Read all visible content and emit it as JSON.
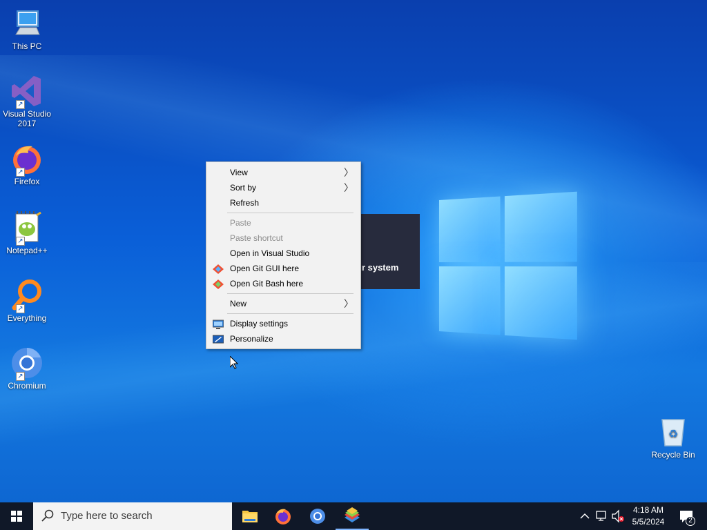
{
  "desktop": {
    "icons": [
      {
        "label": "This PC",
        "icon": "this-pc-icon"
      },
      {
        "label": "Visual Studio 2017",
        "icon": "visual-studio-icon"
      },
      {
        "label": "Firefox",
        "icon": "firefox-icon"
      },
      {
        "label": "Notepad++",
        "icon": "notepad-plus-plus-icon"
      },
      {
        "label": "Everything",
        "icon": "everything-icon"
      },
      {
        "label": "Chromium",
        "icon": "chromium-icon"
      },
      {
        "label": "Recycle Bin",
        "icon": "recycle-bin-icon"
      }
    ],
    "background_popup_text": "ur system"
  },
  "context_menu": {
    "items": [
      {
        "label": "View",
        "submenu": true
      },
      {
        "label": "Sort by",
        "submenu": true
      },
      {
        "label": "Refresh"
      },
      {
        "label": "Paste",
        "disabled": true
      },
      {
        "label": "Paste shortcut",
        "disabled": true
      },
      {
        "label": "Open in Visual Studio"
      },
      {
        "label": "Open Git GUI here",
        "icon": "git-gui-icon"
      },
      {
        "label": "Open Git Bash here",
        "icon": "git-bash-icon"
      },
      {
        "label": "New",
        "submenu": true
      },
      {
        "label": "Display settings",
        "icon": "display-settings-icon"
      },
      {
        "label": "Personalize",
        "icon": "personalize-icon"
      }
    ]
  },
  "taskbar": {
    "search_placeholder": "Type here to search",
    "pinned": [
      "file-explorer-icon",
      "firefox-icon",
      "chromium-icon",
      "bluestacks-icon"
    ],
    "clock_time": "4:18 AM",
    "clock_date": "5/5/2024",
    "notification_count": "2"
  },
  "colors": {
    "taskbar_bg": "#101828",
    "menu_bg": "#f2f2f2",
    "desktop_accent": "#0a5fd8"
  }
}
